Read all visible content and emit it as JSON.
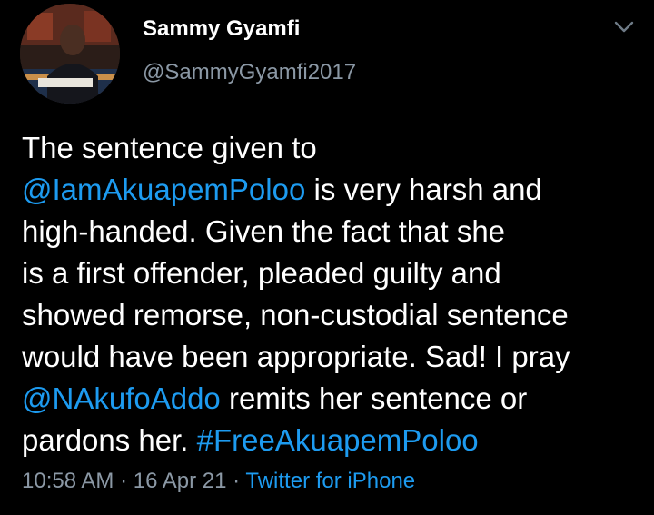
{
  "user": {
    "display_name": "Sammy Gyamfi",
    "handle": "@SammyGyamfi2017"
  },
  "tweet": {
    "lines": [
      {
        "text": "The sentence given to"
      },
      {
        "mention": "@IamAkuapemPoloo",
        "text": " is very harsh and"
      },
      {
        "text": "high-handed. Given the fact that she"
      },
      {
        "text": "is a first offender, pleaded guilty and"
      },
      {
        "text": "showed remorse, non-custodial sentence"
      },
      {
        "text": "would have been appropriate. Sad! I pray"
      },
      {
        "mention": "@NAkufoAddo",
        "text": " remits her sentence or"
      },
      {
        "text": "pardons her. ",
        "hashtag": "#FreeAkuapemPoloo"
      }
    ]
  },
  "meta": {
    "time": "10:58 AM",
    "sep1": " · ",
    "date": "16 Apr 21",
    "sep2": " · ",
    "source": "Twitter for iPhone"
  },
  "icons": {
    "menu": "chevron-down-icon"
  },
  "colors": {
    "background": "#000000",
    "text": "#ffffff",
    "secondary": "#8b98a5",
    "link": "#1d9bf0"
  }
}
